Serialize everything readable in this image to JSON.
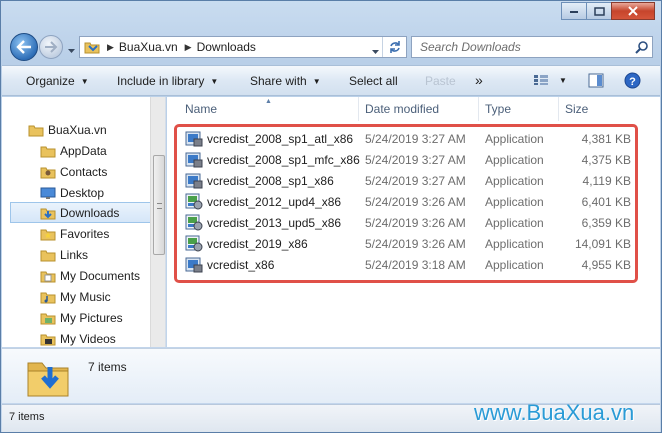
{
  "address": {
    "crumbs": [
      "BuaXua.vn",
      "Downloads"
    ]
  },
  "search": {
    "placeholder": "Search Downloads"
  },
  "toolbar": {
    "organize": "Organize",
    "include_in_library": "Include in library",
    "share_with": "Share with",
    "select_all": "Select all",
    "paste": "Paste",
    "more": "»"
  },
  "sidebar": {
    "items": [
      {
        "label": "BuaXua.vn"
      },
      {
        "label": "AppData"
      },
      {
        "label": "Contacts"
      },
      {
        "label": "Desktop"
      },
      {
        "label": "Downloads"
      },
      {
        "label": "Favorites"
      },
      {
        "label": "Links"
      },
      {
        "label": "My Documents"
      },
      {
        "label": "My Music"
      },
      {
        "label": "My Pictures"
      },
      {
        "label": "My Videos"
      }
    ]
  },
  "columns": {
    "name": "Name",
    "date_modified": "Date modified",
    "type": "Type",
    "size": "Size"
  },
  "files": [
    {
      "name": "vcredist_2008_sp1_atl_x86",
      "date": "5/24/2019 3:27 AM",
      "type": "Application",
      "size": "4,381 KB"
    },
    {
      "name": "vcredist_2008_sp1_mfc_x86",
      "date": "5/24/2019 3:27 AM",
      "type": "Application",
      "size": "4,375 KB"
    },
    {
      "name": "vcredist_2008_sp1_x86",
      "date": "5/24/2019 3:27 AM",
      "type": "Application",
      "size": "4,119 KB"
    },
    {
      "name": "vcredist_2012_upd4_x86",
      "date": "5/24/2019 3:26 AM",
      "type": "Application",
      "size": "6,401 KB"
    },
    {
      "name": "vcredist_2013_upd5_x86",
      "date": "5/24/2019 3:26 AM",
      "type": "Application",
      "size": "6,359 KB"
    },
    {
      "name": "vcredist_2019_x86",
      "date": "5/24/2019 3:26 AM",
      "type": "Application",
      "size": "14,091 KB"
    },
    {
      "name": "vcredist_x86",
      "date": "5/24/2019 3:18 AM",
      "type": "Application",
      "size": "4,955 KB"
    }
  ],
  "details": {
    "count": "7 items"
  },
  "status": {
    "text": "7 items"
  },
  "watermark": "www.BuaXua.vn",
  "colors": {
    "highlight": "#e05048",
    "accent": "#2a9bd6"
  }
}
